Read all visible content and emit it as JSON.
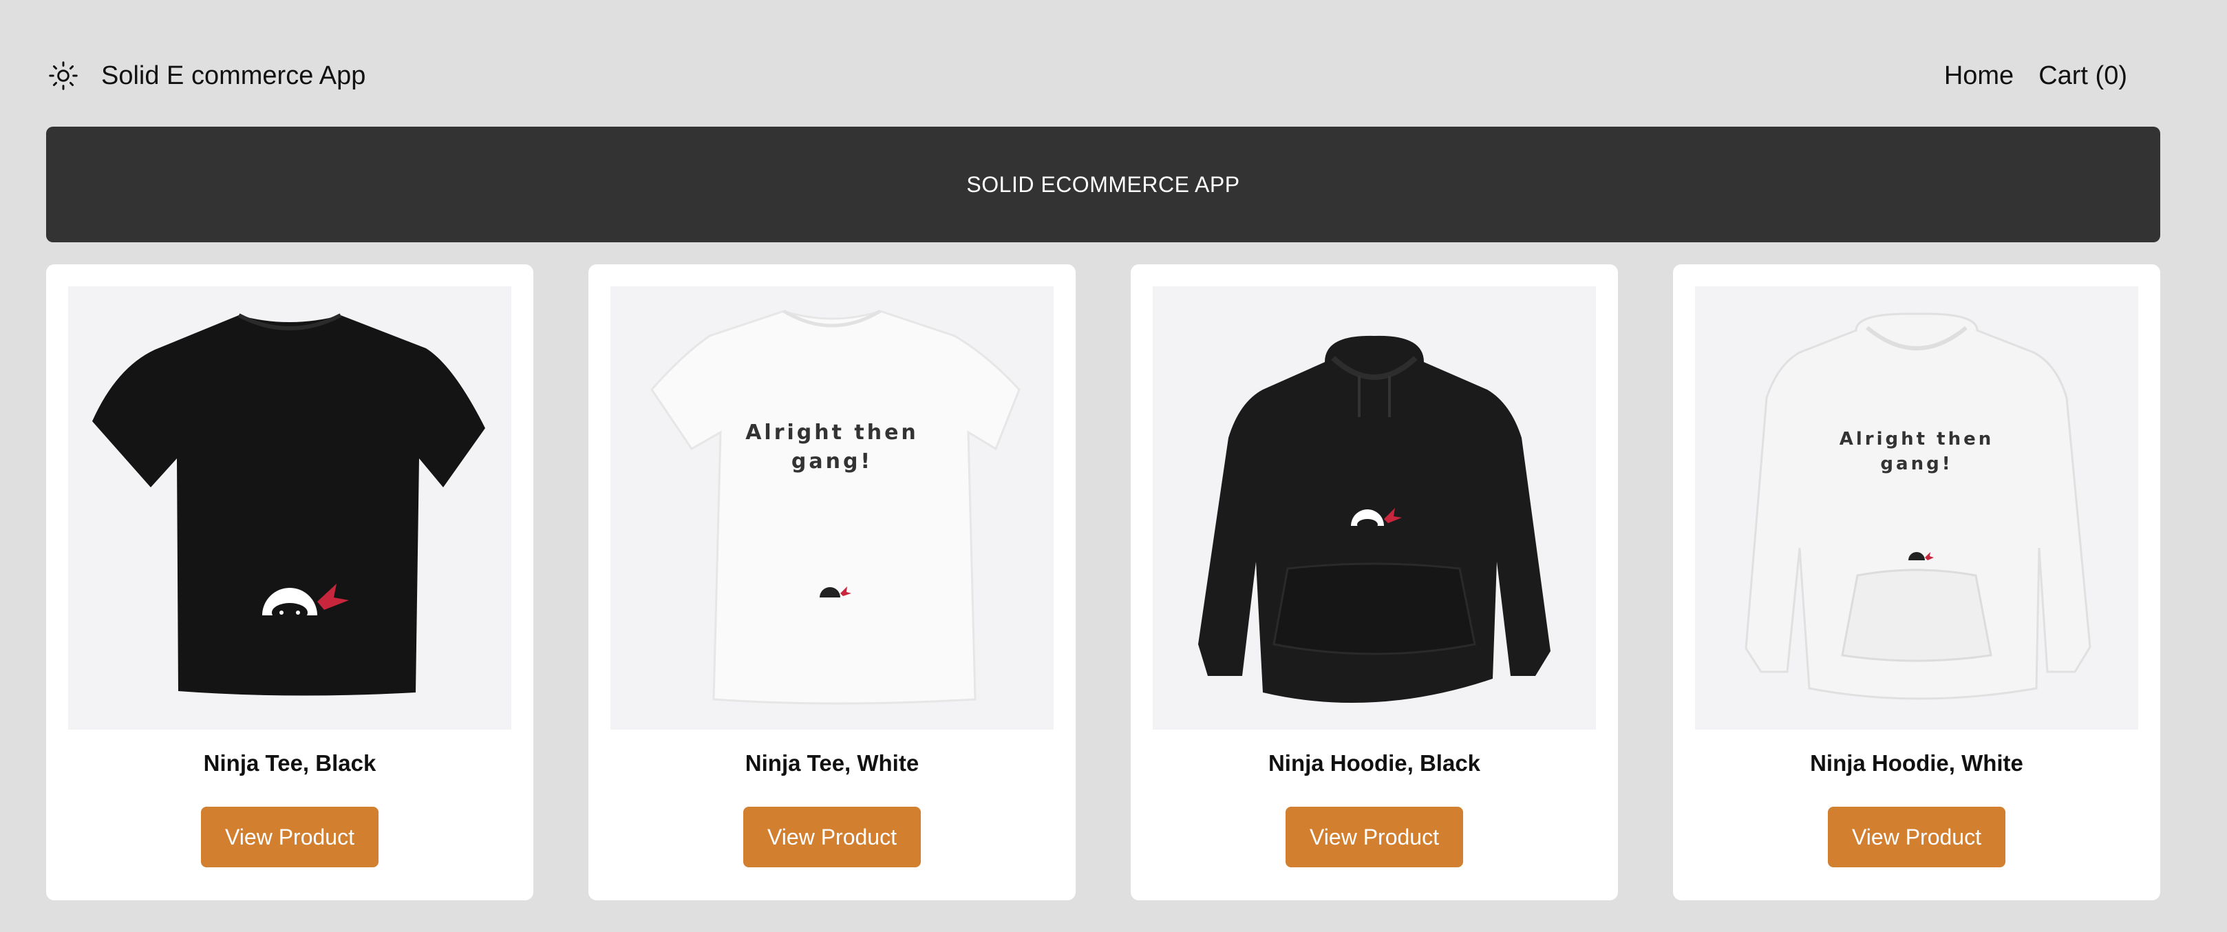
{
  "header": {
    "title": "Solid E commerce App",
    "theme_icon": "sun-icon",
    "nav": {
      "home": "Home",
      "cart": "Cart (0)"
    }
  },
  "banner": {
    "text": "SOLID ECOMMERCE APP"
  },
  "colors": {
    "background": "#dfdfdf",
    "banner": "#333333",
    "button": "#d27f2f",
    "card": "#ffffff"
  },
  "products": [
    {
      "name": "Ninja Tee, Black",
      "button": "View Product",
      "image": "black-tshirt-image"
    },
    {
      "name": "Ninja Tee, White",
      "button": "View Product",
      "image": "white-tshirt-image",
      "print_line1": "Alright then",
      "print_line2": "gang!"
    },
    {
      "name": "Ninja Hoodie, Black",
      "button": "View Product",
      "image": "black-hoodie-image"
    },
    {
      "name": "Ninja Hoodie, White",
      "button": "View Product",
      "image": "white-hoodie-image",
      "print_line1": "Alright then",
      "print_line2": "gang!"
    }
  ]
}
